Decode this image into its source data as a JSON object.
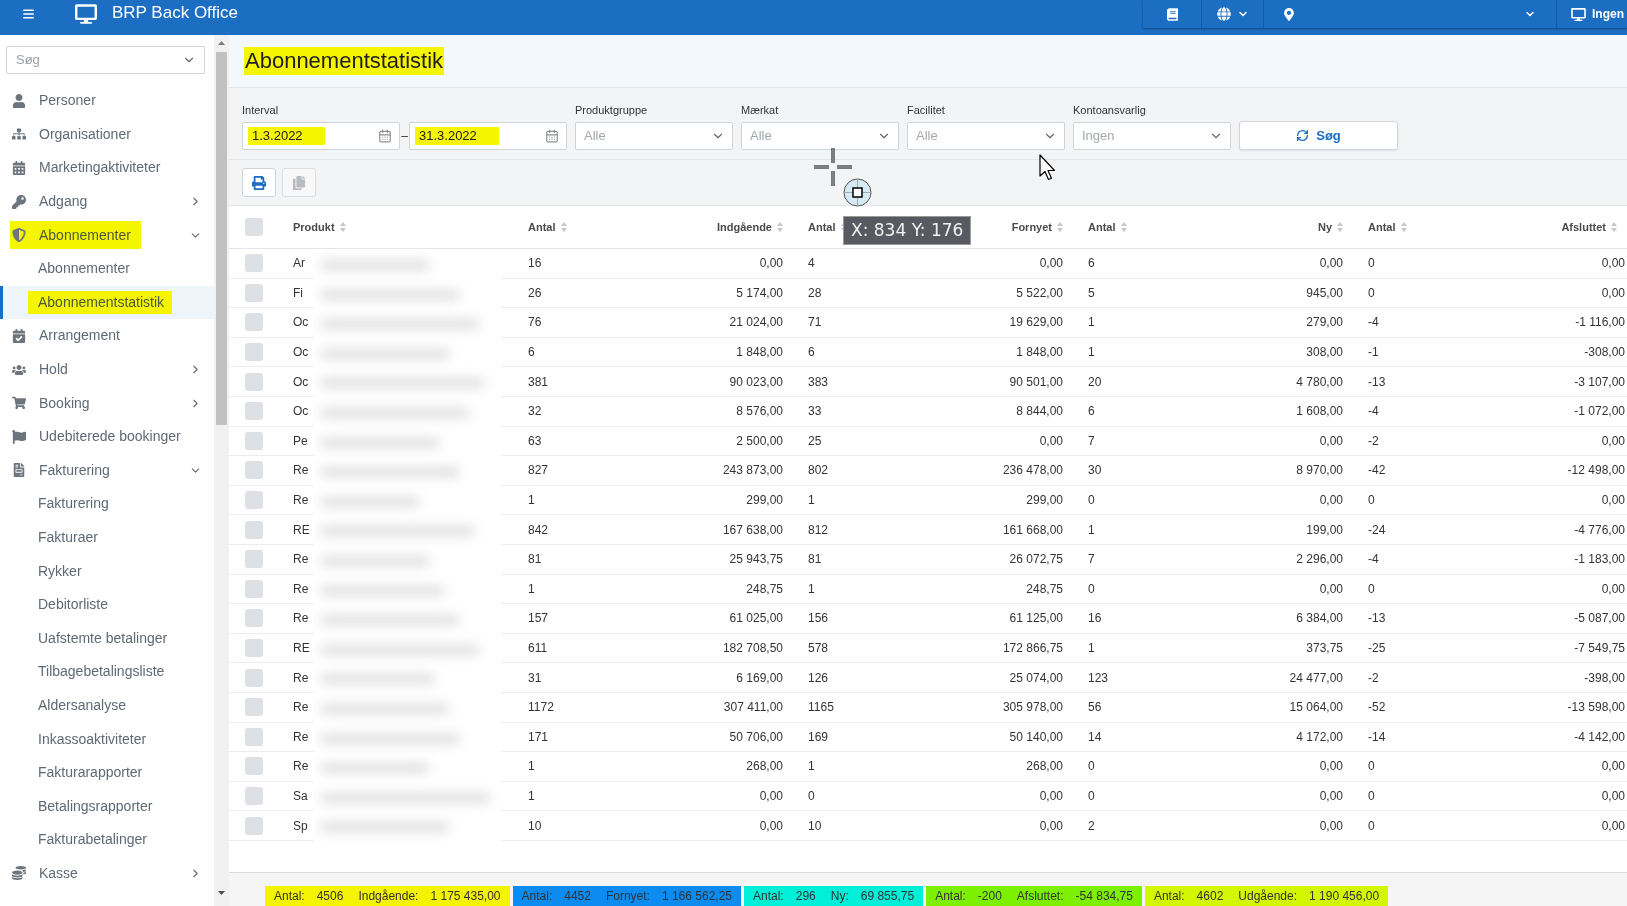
{
  "topbar": {
    "title": "BRP Back Office",
    "workstation": "Ingen"
  },
  "sidebar": {
    "search": {
      "placeholder": "Søg"
    },
    "items": [
      {
        "label": "Personer",
        "kind": "link",
        "selected": false,
        "highlighted": false
      },
      {
        "label": "Organisationer",
        "kind": "link",
        "selected": false,
        "highlighted": false
      },
      {
        "label": "Marketingaktiviteter",
        "kind": "link",
        "selected": false,
        "highlighted": false
      },
      {
        "label": "Adgang",
        "kind": "group",
        "expanded": false,
        "selected": false,
        "highlighted": false
      },
      {
        "label": "Abonnementer",
        "kind": "group",
        "expanded": true,
        "selected": false,
        "highlighted": true,
        "children": [
          {
            "label": "Abonnementer",
            "selected": false,
            "highlighted": false
          },
          {
            "label": "Abonnementstatistik",
            "selected": true,
            "highlighted": true
          }
        ]
      },
      {
        "label": "Arrangement",
        "kind": "link",
        "selected": false,
        "highlighted": false
      },
      {
        "label": "Hold",
        "kind": "group",
        "expanded": false,
        "selected": false,
        "highlighted": false
      },
      {
        "label": "Booking",
        "kind": "group",
        "expanded": false,
        "selected": false,
        "highlighted": false
      },
      {
        "label": "Udebiterede bookinger",
        "kind": "link",
        "selected": false,
        "highlighted": false
      },
      {
        "label": "Fakturering",
        "kind": "group",
        "expanded": true,
        "selected": false,
        "highlighted": false,
        "children": [
          {
            "label": "Fakturering",
            "selected": false,
            "highlighted": false
          },
          {
            "label": "Fakturaer",
            "selected": false,
            "highlighted": false
          },
          {
            "label": "Rykker",
            "selected": false,
            "highlighted": false
          },
          {
            "label": "Debitorliste",
            "selected": false,
            "highlighted": false
          },
          {
            "label": "Uafstemte betalinger",
            "selected": false,
            "highlighted": false
          },
          {
            "label": "Tilbagebetalingsliste",
            "selected": false,
            "highlighted": false
          },
          {
            "label": "Aldersanalyse",
            "selected": false,
            "highlighted": false
          },
          {
            "label": "Inkassoaktiviteter",
            "selected": false,
            "highlighted": false
          },
          {
            "label": "Fakturarapporter",
            "selected": false,
            "highlighted": false
          },
          {
            "label": "Betalingsrapporter",
            "selected": false,
            "highlighted": false
          },
          {
            "label": "Fakturabetalinger",
            "selected": false,
            "highlighted": false
          }
        ]
      },
      {
        "label": "Kasse",
        "kind": "group",
        "expanded": false,
        "selected": false,
        "highlighted": false
      }
    ]
  },
  "page": {
    "title": "Abonnementstatistik",
    "highlighted": true
  },
  "filters": {
    "interval": {
      "label": "Interval",
      "from": {
        "value": "1.3.2022",
        "highlighted": true
      },
      "separator": "–",
      "to": {
        "value": "31.3.2022",
        "highlighted": true
      }
    },
    "dropdowns": [
      {
        "label": "Produktgruppe",
        "placeholder": "Alle"
      },
      {
        "label": "Mærkat",
        "placeholder": "Alle"
      },
      {
        "label": "Facilitet",
        "placeholder": "Alle"
      },
      {
        "label": "Kontoansvarlig",
        "placeholder": "Ingen"
      }
    ],
    "search_button": "Søg"
  },
  "toolbar": [
    {
      "disabled": false
    },
    {
      "disabled": true
    }
  ],
  "table": {
    "select_all_checked": false,
    "columns": [
      {
        "label": "Produkt",
        "kind": "text"
      },
      {
        "label": "Antal",
        "kind": "count"
      },
      {
        "label": "Indgående",
        "kind": "amount"
      },
      {
        "label": "Antal",
        "kind": "count"
      },
      {
        "label": "Fornyet",
        "kind": "amount"
      },
      {
        "label": "Antal",
        "kind": "count"
      },
      {
        "label": "Ny",
        "kind": "amount"
      },
      {
        "label": "Antal",
        "kind": "count"
      },
      {
        "label": "Afsluttet",
        "kind": "amount"
      }
    ],
    "rows": [
      {
        "checked": false,
        "cells": [
          "Ar",
          "16",
          "0,00",
          "4",
          "0,00",
          "6",
          "0,00",
          "0",
          "0,00"
        ]
      },
      {
        "checked": false,
        "cells": [
          "Fi",
          "26",
          "5 174,00",
          "28",
          "5 522,00",
          "5",
          "945,00",
          "0",
          "0,00"
        ]
      },
      {
        "checked": false,
        "cells": [
          "Oc",
          "76",
          "21 024,00",
          "71",
          "19 629,00",
          "1",
          "279,00",
          "-4",
          "-1 116,00"
        ]
      },
      {
        "checked": false,
        "cells": [
          "Oc",
          "6",
          "1 848,00",
          "6",
          "1 848,00",
          "1",
          "308,00",
          "-1",
          "-308,00"
        ]
      },
      {
        "checked": false,
        "cells": [
          "Oc",
          "381",
          "90 023,00",
          "383",
          "90 501,00",
          "20",
          "4 780,00",
          "-13",
          "-3 107,00"
        ]
      },
      {
        "checked": false,
        "cells": [
          "Oc",
          "32",
          "8 576,00",
          "33",
          "8 844,00",
          "6",
          "1 608,00",
          "-4",
          "-1 072,00"
        ]
      },
      {
        "checked": false,
        "cells": [
          "Pe",
          "63",
          "2 500,00",
          "25",
          "0,00",
          "7",
          "0,00",
          "-2",
          "0,00"
        ]
      },
      {
        "checked": false,
        "cells": [
          "Re",
          "827",
          "243 873,00",
          "802",
          "236 478,00",
          "30",
          "8 970,00",
          "-42",
          "-12 498,00"
        ]
      },
      {
        "checked": false,
        "cells": [
          "Re",
          "1",
          "299,00",
          "1",
          "299,00",
          "0",
          "0,00",
          "0",
          "0,00"
        ]
      },
      {
        "checked": false,
        "cells": [
          "RE",
          "842",
          "167 638,00",
          "812",
          "161 668,00",
          "1",
          "199,00",
          "-24",
          "-4 776,00"
        ]
      },
      {
        "checked": false,
        "cells": [
          "Re",
          "81",
          "25 943,75",
          "81",
          "26 072,75",
          "7",
          "2 296,00",
          "-4",
          "-1 183,00"
        ]
      },
      {
        "checked": false,
        "cells": [
          "Re",
          "1",
          "248,75",
          "1",
          "248,75",
          "0",
          "0,00",
          "0",
          "0,00"
        ]
      },
      {
        "checked": false,
        "cells": [
          "Re",
          "157",
          "61 025,00",
          "156",
          "61 125,00",
          "16",
          "6 384,00",
          "-13",
          "-5 087,00"
        ]
      },
      {
        "checked": false,
        "cells": [
          "RE",
          "611",
          "182 708,50",
          "578",
          "172 866,75",
          "1",
          "373,75",
          "-25",
          "-7 549,75"
        ]
      },
      {
        "checked": false,
        "cells": [
          "Re",
          "31",
          "6 169,00",
          "126",
          "25 074,00",
          "123",
          "24 477,00",
          "-2",
          "-398,00"
        ]
      },
      {
        "checked": false,
        "cells": [
          "Re",
          "1172",
          "307 411,00",
          "1165",
          "305 978,00",
          "56",
          "15 064,00",
          "-52",
          "-13 598,00"
        ]
      },
      {
        "checked": false,
        "cells": [
          "Re",
          "171",
          "50 706,00",
          "169",
          "50 140,00",
          "14",
          "4 172,00",
          "-14",
          "-4 142,00"
        ]
      },
      {
        "checked": false,
        "cells": [
          "Re",
          "1",
          "268,00",
          "1",
          "268,00",
          "0",
          "0,00",
          "0",
          "0,00"
        ]
      },
      {
        "checked": false,
        "cells": [
          "Sa",
          "1",
          "0,00",
          "0",
          "0,00",
          "0",
          "0,00",
          "0",
          "0,00"
        ]
      },
      {
        "checked": false,
        "cells": [
          "Sp",
          "10",
          "0,00",
          "10",
          "0,00",
          "2",
          "0,00",
          "0",
          "0,00"
        ]
      }
    ]
  },
  "totals": [
    {
      "color": "#f4f400",
      "items": [
        {
          "label": "Antal:",
          "value": "4506"
        },
        {
          "label": "Indgående:",
          "value": "1 175 435,00"
        }
      ]
    },
    {
      "color": "#0c8cf0",
      "items": [
        {
          "label": "Antal:",
          "value": "4452"
        },
        {
          "label": "Fornyet:",
          "value": "1 166 562,25"
        }
      ]
    },
    {
      "color": "#00efd8",
      "items": [
        {
          "label": "Antal:",
          "value": "296"
        },
        {
          "label": "Ny:",
          "value": "69 855,75"
        }
      ]
    },
    {
      "color": "#7df000",
      "items": [
        {
          "label": "Antal:",
          "value": "-200"
        },
        {
          "label": "Afsluttet:",
          "value": "-54 834,75"
        }
      ]
    },
    {
      "color": "#d3f700",
      "items": [
        {
          "label": "Antal:",
          "value": "4602"
        },
        {
          "label": "Udgående:",
          "value": "1 190 456,00"
        }
      ]
    }
  ],
  "screen_capture": {
    "coordinates": "X: 834 Y: 176"
  }
}
